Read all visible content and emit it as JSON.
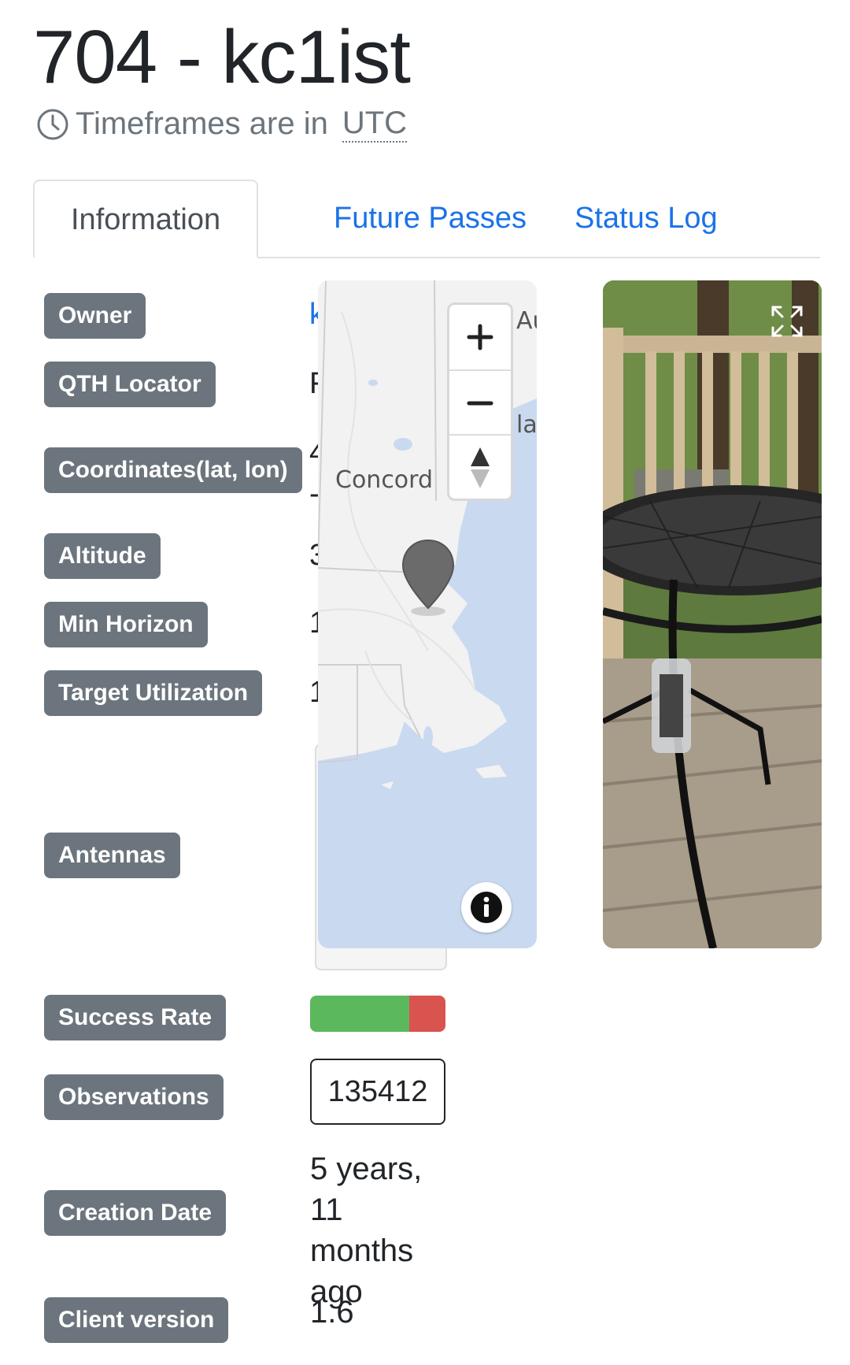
{
  "header": {
    "title": "704 - kc1ist",
    "timezone_text": "Timeframes are in",
    "timezone_abbr": "UTC",
    "timezone_icon": "clock-icon"
  },
  "tabs": [
    {
      "label": "Information",
      "active": true
    },
    {
      "label": "Future Passes",
      "active": false
    },
    {
      "label": "Status Log",
      "active": false
    }
  ],
  "fields": {
    "owner": {
      "label": "Owner",
      "value_peek": "k"
    },
    "qth": {
      "label": "QTH Locator",
      "value_peek": "F"
    },
    "coords": {
      "label": "Coordinates(lat, lon)",
      "value_peek_lat": "4",
      "value_peek_lon": "-"
    },
    "altitude": {
      "label": "Altitude",
      "value_peek": "3"
    },
    "min_horizon": {
      "label": "Min Horizon",
      "value_peek": "1"
    },
    "target_utilization": {
      "label": "Target Utilization",
      "value_peek": "1"
    },
    "antennas": {
      "label": "Antennas"
    },
    "success_rate": {
      "label": "Success Rate",
      "success_fraction": 0.73,
      "color_success": "#5cb85c",
      "color_fail": "#d9534f"
    },
    "observations": {
      "label": "Observations",
      "value": "135412"
    },
    "creation_date": {
      "label": "Creation Date",
      "value": "5 years, 11 months ago"
    },
    "client_version": {
      "label": "Client version",
      "value": "1.6"
    }
  },
  "map": {
    "city_label": "Concord",
    "edge_label_1": "Au",
    "edge_label_2": "la",
    "zoom_in_icon": "plus-icon",
    "zoom_out_icon": "minus-icon",
    "compass_icon": "compass-icon",
    "info_icon": "info-icon",
    "marker_icon": "map-pin-icon"
  },
  "photo": {
    "expand_icon": "expand-icon"
  },
  "colors": {
    "accent": "#1a73e8",
    "badge": "#6c757d",
    "water": "#c9d9f0"
  }
}
